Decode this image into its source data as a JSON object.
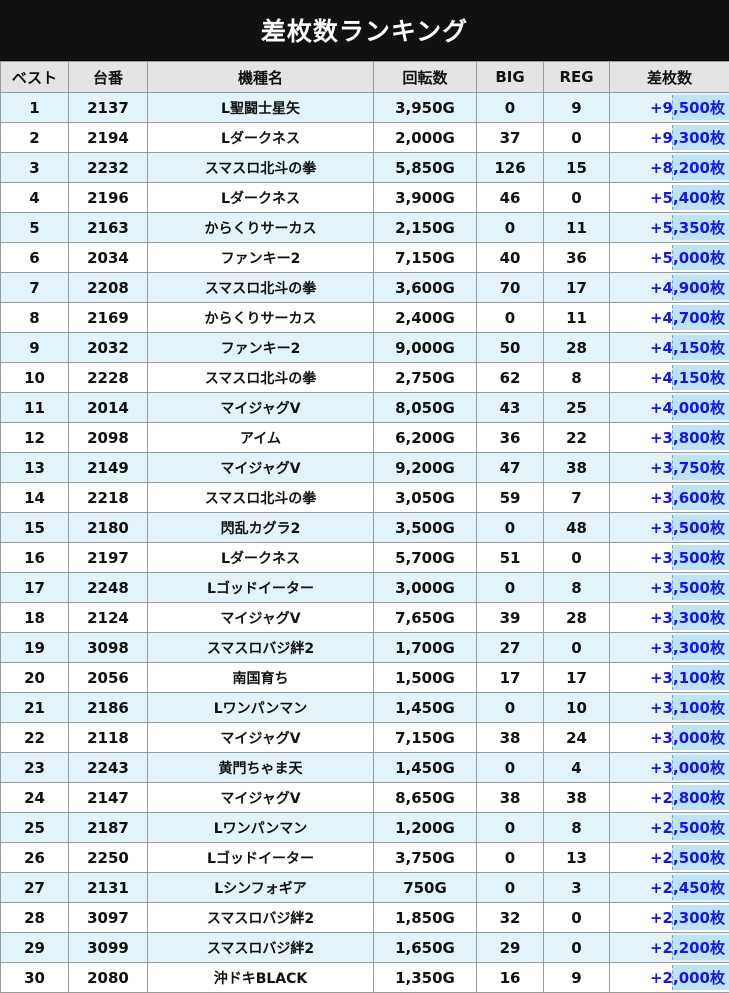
{
  "title": "差枚数ランキング",
  "headers": {
    "rank": "ベスト",
    "machine_no": "台番",
    "model": "機種名",
    "spins": "回転数",
    "big": "BIG",
    "reg": "REG",
    "diff": "差枚数"
  },
  "rows": [
    {
      "rank": "1",
      "machine_no": "2137",
      "model": "L聖闘士星矢",
      "spins": "3,950G",
      "big": "0",
      "reg": "9",
      "diff": "+9,500枚"
    },
    {
      "rank": "2",
      "machine_no": "2194",
      "model": "Lダークネス",
      "spins": "2,000G",
      "big": "37",
      "reg": "0",
      "diff": "+9,300枚"
    },
    {
      "rank": "3",
      "machine_no": "2232",
      "model": "スマスロ北斗の拳",
      "spins": "5,850G",
      "big": "126",
      "reg": "15",
      "diff": "+8,200枚"
    },
    {
      "rank": "4",
      "machine_no": "2196",
      "model": "Lダークネス",
      "spins": "3,900G",
      "big": "46",
      "reg": "0",
      "diff": "+5,400枚"
    },
    {
      "rank": "5",
      "machine_no": "2163",
      "model": "からくりサーカス",
      "spins": "2,150G",
      "big": "0",
      "reg": "11",
      "diff": "+5,350枚"
    },
    {
      "rank": "6",
      "machine_no": "2034",
      "model": "ファンキー2",
      "spins": "7,150G",
      "big": "40",
      "reg": "36",
      "diff": "+5,000枚"
    },
    {
      "rank": "7",
      "machine_no": "2208",
      "model": "スマスロ北斗の拳",
      "spins": "3,600G",
      "big": "70",
      "reg": "17",
      "diff": "+4,900枚"
    },
    {
      "rank": "8",
      "machine_no": "2169",
      "model": "からくりサーカス",
      "spins": "2,400G",
      "big": "0",
      "reg": "11",
      "diff": "+4,700枚"
    },
    {
      "rank": "9",
      "machine_no": "2032",
      "model": "ファンキー2",
      "spins": "9,000G",
      "big": "50",
      "reg": "28",
      "diff": "+4,150枚"
    },
    {
      "rank": "10",
      "machine_no": "2228",
      "model": "スマスロ北斗の拳",
      "spins": "2,750G",
      "big": "62",
      "reg": "8",
      "diff": "+4,150枚"
    },
    {
      "rank": "11",
      "machine_no": "2014",
      "model": "マイジャグV",
      "spins": "8,050G",
      "big": "43",
      "reg": "25",
      "diff": "+4,000枚"
    },
    {
      "rank": "12",
      "machine_no": "2098",
      "model": "アイム",
      "spins": "6,200G",
      "big": "36",
      "reg": "22",
      "diff": "+3,800枚"
    },
    {
      "rank": "13",
      "machine_no": "2149",
      "model": "マイジャグV",
      "spins": "9,200G",
      "big": "47",
      "reg": "38",
      "diff": "+3,750枚"
    },
    {
      "rank": "14",
      "machine_no": "2218",
      "model": "スマスロ北斗の拳",
      "spins": "3,050G",
      "big": "59",
      "reg": "7",
      "diff": "+3,600枚"
    },
    {
      "rank": "15",
      "machine_no": "2180",
      "model": "閃乱カグラ2",
      "spins": "3,500G",
      "big": "0",
      "reg": "48",
      "diff": "+3,500枚"
    },
    {
      "rank": "16",
      "machine_no": "2197",
      "model": "Lダークネス",
      "spins": "5,700G",
      "big": "51",
      "reg": "0",
      "diff": "+3,500枚"
    },
    {
      "rank": "17",
      "machine_no": "2248",
      "model": "Lゴッドイーター",
      "spins": "3,000G",
      "big": "0",
      "reg": "8",
      "diff": "+3,500枚"
    },
    {
      "rank": "18",
      "machine_no": "2124",
      "model": "マイジャグV",
      "spins": "7,650G",
      "big": "39",
      "reg": "28",
      "diff": "+3,300枚"
    },
    {
      "rank": "19",
      "machine_no": "3098",
      "model": "スマスロバジ絆2",
      "spins": "1,700G",
      "big": "27",
      "reg": "0",
      "diff": "+3,300枚"
    },
    {
      "rank": "20",
      "machine_no": "2056",
      "model": "南国育ち",
      "spins": "1,500G",
      "big": "17",
      "reg": "17",
      "diff": "+3,100枚"
    },
    {
      "rank": "21",
      "machine_no": "2186",
      "model": "Lワンパンマン",
      "spins": "1,450G",
      "big": "0",
      "reg": "10",
      "diff": "+3,100枚"
    },
    {
      "rank": "22",
      "machine_no": "2118",
      "model": "マイジャグV",
      "spins": "7,150G",
      "big": "38",
      "reg": "24",
      "diff": "+3,000枚"
    },
    {
      "rank": "23",
      "machine_no": "2243",
      "model": "黄門ちゃま天",
      "spins": "1,450G",
      "big": "0",
      "reg": "4",
      "diff": "+3,000枚"
    },
    {
      "rank": "24",
      "machine_no": "2147",
      "model": "マイジャグV",
      "spins": "8,650G",
      "big": "38",
      "reg": "38",
      "diff": "+2,800枚"
    },
    {
      "rank": "25",
      "machine_no": "2187",
      "model": "Lワンパンマン",
      "spins": "1,200G",
      "big": "0",
      "reg": "8",
      "diff": "+2,500枚"
    },
    {
      "rank": "26",
      "machine_no": "2250",
      "model": "Lゴッドイーター",
      "spins": "3,750G",
      "big": "0",
      "reg": "13",
      "diff": "+2,500枚"
    },
    {
      "rank": "27",
      "machine_no": "2131",
      "model": "Lシンフォギア",
      "spins": "750G",
      "big": "0",
      "reg": "3",
      "diff": "+2,450枚"
    },
    {
      "rank": "28",
      "machine_no": "3097",
      "model": "スマスロバジ絆2",
      "spins": "1,850G",
      "big": "32",
      "reg": "0",
      "diff": "+2,300枚"
    },
    {
      "rank": "29",
      "machine_no": "3099",
      "model": "スマスロバジ絆2",
      "spins": "1,650G",
      "big": "29",
      "reg": "0",
      "diff": "+2,200枚"
    },
    {
      "rank": "30",
      "machine_no": "2080",
      "model": "沖ドキBLACK",
      "spins": "1,350G",
      "big": "16",
      "reg": "9",
      "diff": "+2,000枚"
    }
  ]
}
